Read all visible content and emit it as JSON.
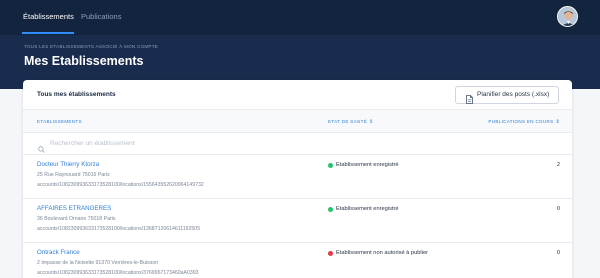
{
  "nav": {
    "tabs": [
      {
        "label": "Établissements",
        "active": true
      },
      {
        "label": "Publications",
        "active": false
      }
    ]
  },
  "header": {
    "subtitle": "TOUS LES ETABLISSEMENTS ASSOCIÉ À MON COMPTE",
    "title": "Mes Etablissements"
  },
  "card": {
    "title": "Tous mes établissements",
    "plan_button": "Planifier des posts (.xlsx)"
  },
  "table": {
    "columns": [
      {
        "label": "ETABLISSEMENTS",
        "sort": ""
      },
      {
        "label": "ETAT DE SANTÉ",
        "sort": "⇕"
      },
      {
        "label": "PUBLICATIONS EN COURS",
        "sort": "⇕"
      }
    ],
    "search_placeholder": "Rechercher un établissement",
    "rows": [
      {
        "name": "Docteur Thierry Ktorza",
        "address": "25 Rue Raynouard 75016 Paris",
        "account": "accounts/108230993633173528100/locations/155643552620964149732",
        "status": "Etablissement enregistré",
        "status_color": "#23c26b",
        "count": "2"
      },
      {
        "name": "AFFAIRES ETRANGERES",
        "address": "36 Boulevard Ornano 75018 Paris",
        "account": "accounts/108230993633173528100/locations/13687120614611192505",
        "status": "Etablissement enregistré",
        "status_color": "#23c26b",
        "count": "0"
      },
      {
        "name": "Ontrack France",
        "address": "2 Impasse de la Noisette 91370 Verrières-le-Buisson",
        "account": "accounts/108230993633173528100/locations/3769967173460aA0393",
        "status": "Etablissement non autorisé à publier",
        "status_color": "#e53945",
        "count": "0"
      }
    ]
  },
  "colors": {
    "topbar": "#13243f",
    "hero": "#192c4d",
    "accent": "#2f7ed8",
    "ok": "#23c26b",
    "error": "#e53945"
  },
  "icons": {
    "avatar": "user-avatar",
    "file": "file-icon",
    "search": "search-icon"
  }
}
